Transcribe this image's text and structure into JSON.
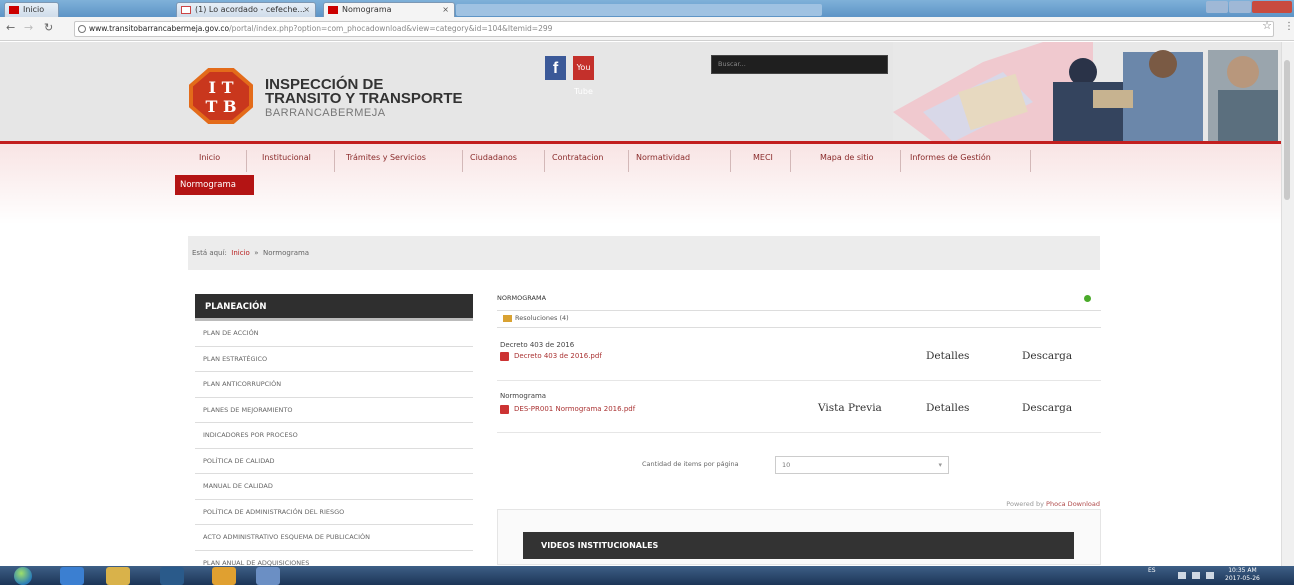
{
  "browser": {
    "tabs": [
      {
        "label": "Inicio"
      },
      {
        "label": "(1) Lo acordado - cefeche..."
      },
      {
        "label": "Nomograma"
      }
    ],
    "url_host": "www.transitobarrancabermeja.gov.co",
    "url_path": "/portal/index.php?option=com_phocadownload&view=category&id=104&Itemid=299"
  },
  "header": {
    "logo_letters_top": "I T",
    "logo_letters_bottom": "T B",
    "brand_line1": "INSPECCIÓN DE",
    "brand_line2": "TRANSITO Y TRANSPORTE",
    "brand_city": "BARRANCABERMEJA",
    "search_placeholder": "Buscar...",
    "facebook_glyph": "f",
    "youtube_glyph": "You Tube"
  },
  "nav": {
    "items": [
      "Inicio",
      "Institucional",
      "Trámites y Servicios",
      "Ciudadanos",
      "Contratacion",
      "Normatividad",
      "MECI",
      "Mapa de sitio",
      "Informes de Gestión"
    ],
    "active": "Normograma"
  },
  "breadcrumb": {
    "prefix": "Está aquí:",
    "home": "Inicio",
    "separator": "»",
    "current": "Normograma"
  },
  "sidebar": {
    "heading": "PLANEACIÓN",
    "items": [
      "PLAN DE ACCIÓN",
      "PLAN ESTRATÉGICO",
      "PLAN ANTICORRUPCIÓN",
      "PLANES DE MEJORAMIENTO",
      "INDICADORES POR PROCESO",
      "POLÍTICA DE CALIDAD",
      "MANUAL DE CALIDAD",
      "POLÍTICA DE ADMINISTRACIÓN DEL RIESGO",
      "ACTO ADMINISTRATIVO ESQUEMA DE PUBLICACIÓN",
      "PLAN ANUAL DE ADQUISICIONES"
    ]
  },
  "content": {
    "title": "NORMOGRAMA",
    "folder": "Resoluciones (4)",
    "documents": [
      {
        "title": "Decreto 403 de 2016",
        "file": "Decreto 403 de 2016.pdf",
        "preview": "",
        "details": "Detalles",
        "download": "Descarga"
      },
      {
        "title": "Normograma",
        "file": "DES-PR001 Normograma 2016.pdf",
        "preview": "Vista Previa",
        "details": "Detalles",
        "download": "Descarga"
      }
    ],
    "pager_label": "Cantidad de items por página",
    "pager_value": "10",
    "powered_prefix": "Powered by",
    "powered_link": "Phoca Download",
    "videos_heading": "VIDEOS INSTITUCIONALES"
  },
  "taskbar": {
    "language": "ES",
    "time": "10:35 AM",
    "date": "2017-05-26"
  }
}
